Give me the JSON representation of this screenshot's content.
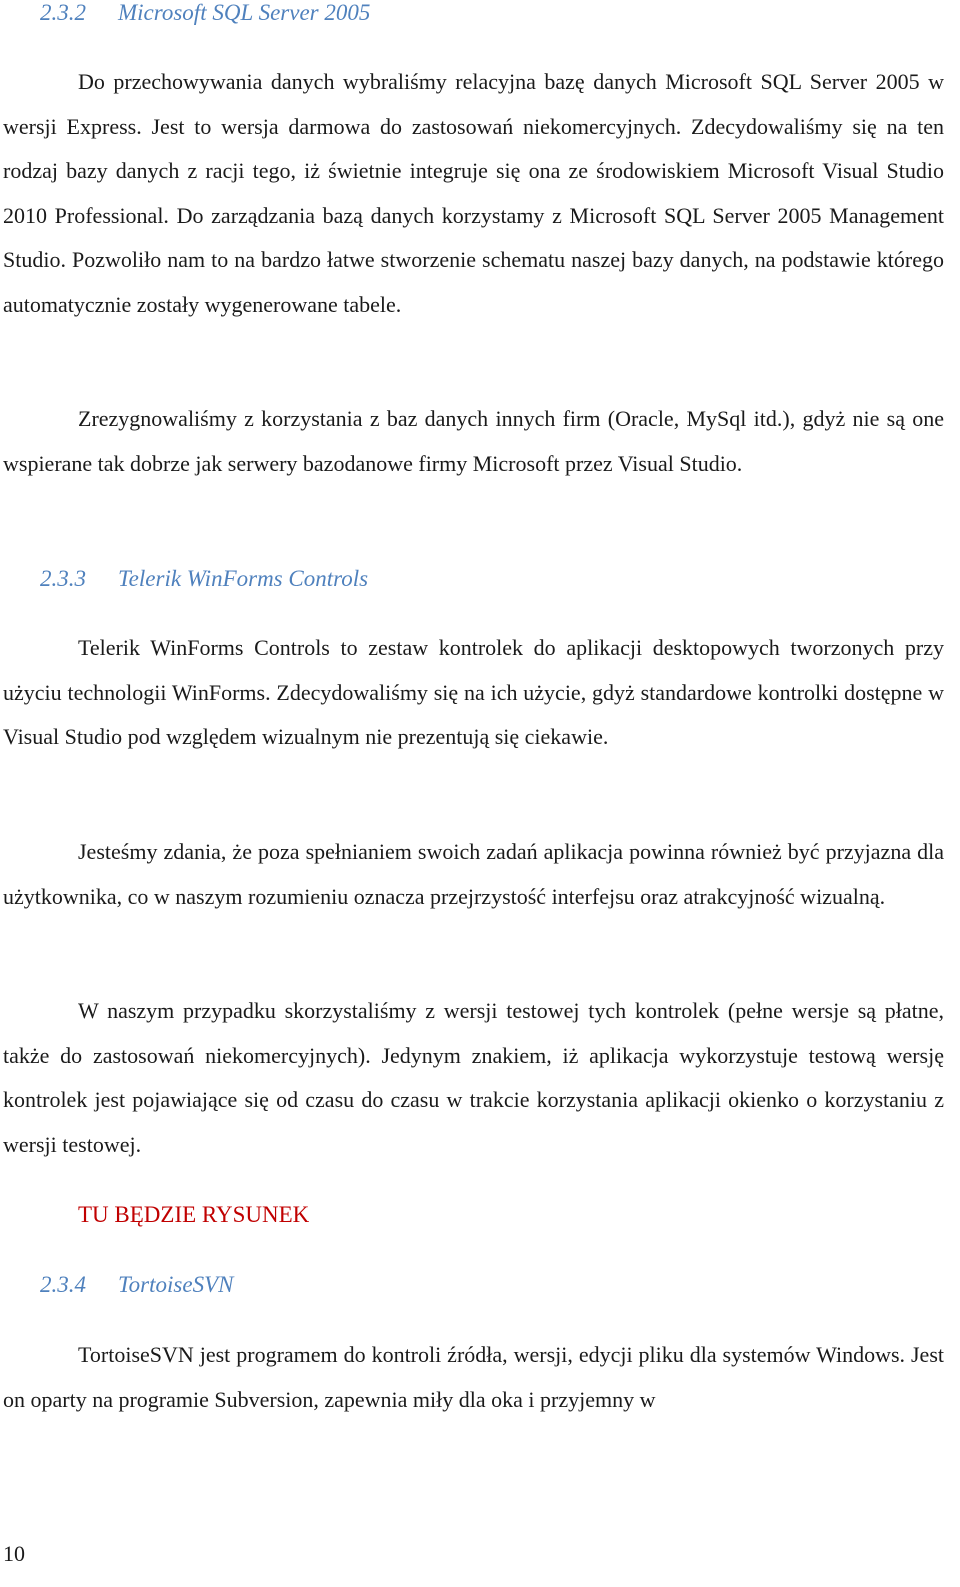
{
  "document": {
    "sections": [
      {
        "number": "2.3.2",
        "title": "Microsoft SQL Server 2005",
        "paragraphs": [
          "Do przechowywania danych wybraliśmy relacyjna bazę danych Microsoft SQL Server 2005 w wersji Express. Jest to wersja darmowa do zastosowań niekomercyjnych. Zdecydowaliśmy się na ten rodzaj bazy danych z racji tego, iż świetnie integruje się ona ze środowiskiem Microsoft Visual Studio 2010 Professional. Do zarządzania bazą danych korzystamy z Microsoft SQL Server 2005 Management Studio. Pozwoliło nam to na bardzo łatwe stworzenie schematu naszej bazy danych, na podstawie którego automatycznie zostały wygenerowane tabele.",
          "Zrezygnowaliśmy z korzystania z baz danych innych firm (Oracle, MySql itd.), gdyż nie są one wspierane tak dobrze jak serwery bazodanowe firmy Microsoft przez Visual Studio."
        ]
      },
      {
        "number": "2.3.3",
        "title": "Telerik WinForms Controls",
        "paragraphs": [
          "Telerik WinForms Controls to zestaw kontrolek do aplikacji desktopowych tworzonych przy użyciu technologii WinForms. Zdecydowaliśmy się na ich użycie, gdyż standardowe kontrolki dostępne w Visual Studio pod względem wizualnym nie prezentują się ciekawie.",
          "Jesteśmy zdania, że poza spełnianiem swoich zadań aplikacja powinna również być przyjazna dla użytkownika, co w naszym rozumieniu oznacza przejrzystość interfejsu oraz atrakcyjność wizualną.",
          "W naszym przypadku skorzystaliśmy z wersji testowej tych kontrolek (pełne wersje są płatne, także do zastosowań niekomercyjnych). Jedynym znakiem, iż aplikacja wykorzystuje testową wersję kontrolek jest pojawiające się od czasu do czasu w trakcie korzystania aplikacji okienko o korzystaniu z wersji testowej."
        ],
        "placeholder": "TU BĘDZIE RYSUNEK"
      },
      {
        "number": "2.3.4",
        "title": "TortoiseSVN",
        "paragraphs": [
          "TortoiseSVN jest programem do kontroli źródła, wersji, edycji pliku dla systemów Windows. Jest on oparty na programie Subversion, zapewnia miły dla oka i przyjemny w"
        ]
      }
    ],
    "page_number": "10",
    "colors": {
      "heading": "#4f81bd",
      "placeholder": "#c00000",
      "text": "#1a1a1a"
    }
  }
}
